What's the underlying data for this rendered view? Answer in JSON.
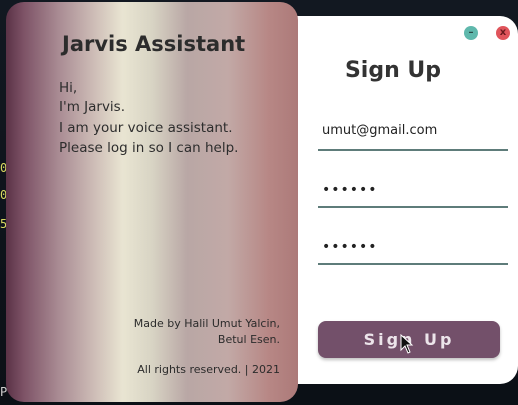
{
  "left_panel": {
    "title": "Jarvis Assistant",
    "greeting": {
      "line1": "Hi,",
      "line2": "I'm Jarvis.",
      "line3": "I am your voice assistant.",
      "line4": "Please log in so I can help."
    },
    "credit_line1": "Made by Halil Umut Yalcin,",
    "credit_line2": "Betul Esen.",
    "rights": "All rights reserved. | 2021"
  },
  "signup": {
    "title": "Sign Up",
    "email_value": "umut@gmail.com",
    "password_value": "••••••",
    "confirm_value": "••••••",
    "button_label": "Sign Up"
  },
  "window_controls": {
    "minimize_symbol": "–",
    "close_symbol": "x"
  },
  "edge_glyphs": [
    "0",
    "0",
    "5",
    "P"
  ],
  "colors": {
    "button": "#73506a",
    "underline": "#5e7c7a",
    "minimize": "#5fb8ac",
    "close": "#e0545b"
  }
}
